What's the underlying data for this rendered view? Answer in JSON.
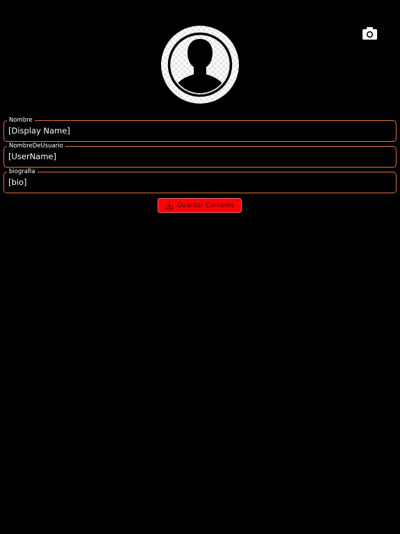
{
  "profile": {
    "avatar_icon": "user-silhouette-icon",
    "camera_icon": "camera-icon"
  },
  "form": {
    "fields": [
      {
        "label": "Nombre",
        "value": "[Display Name]"
      },
      {
        "label": "NombreDeUsuario",
        "value": "[UserName]"
      },
      {
        "label": "biografia",
        "value": "[bio]"
      }
    ],
    "save_button": {
      "label": "Guardar Cambios",
      "icon": "download-icon"
    }
  },
  "colors": {
    "background": "#000000",
    "field_border": "#e1753d",
    "button_background": "#ff0000",
    "button_text": "#4a0000",
    "text": "#ffffff"
  }
}
